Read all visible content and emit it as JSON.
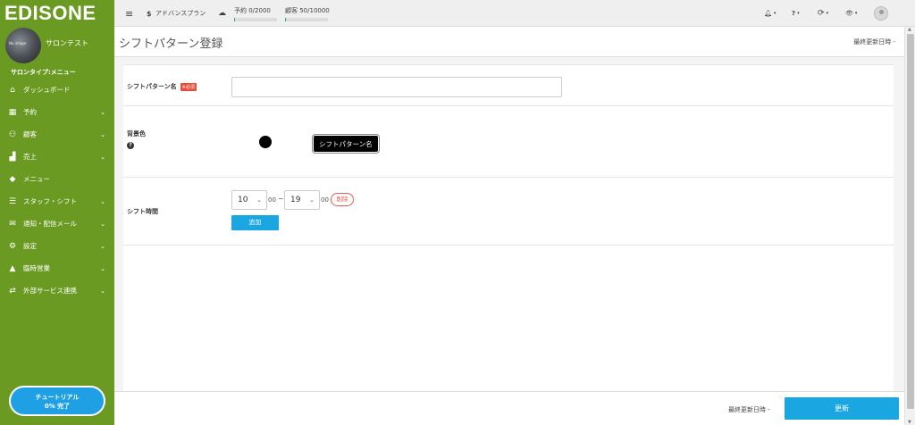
{
  "brand": "EDISONE",
  "profile": {
    "name": "サロンテスト",
    "image_text": "No image",
    "salon_type": "サロンタイプ:メニュー"
  },
  "sidebar": {
    "items": [
      {
        "icon": "home-icon",
        "glyph": "⌂",
        "label": "ダッシュボード",
        "has_chevron": false
      },
      {
        "icon": "calendar-icon",
        "glyph": "▦",
        "label": "予約",
        "has_chevron": true
      },
      {
        "icon": "users-icon",
        "glyph": "⚇",
        "label": "顧客",
        "has_chevron": true
      },
      {
        "icon": "chart-icon",
        "glyph": "▟",
        "label": "売上",
        "has_chevron": true
      },
      {
        "icon": "tag-icon",
        "glyph": "◆",
        "label": "メニュー",
        "has_chevron": false
      },
      {
        "icon": "sliders-icon",
        "glyph": "☰",
        "label": "スタッフ・シフト",
        "has_chevron": true
      },
      {
        "icon": "mail-icon",
        "glyph": "✉",
        "label": "通知・配信メール",
        "has_chevron": true
      },
      {
        "icon": "gear-icon",
        "glyph": "⚙",
        "label": "設定",
        "has_chevron": true
      },
      {
        "icon": "warning-icon",
        "glyph": "▲",
        "label": "臨時営業",
        "has_chevron": true
      },
      {
        "icon": "exchange-icon",
        "glyph": "⇄",
        "label": "外部サービス連携",
        "has_chevron": true
      }
    ],
    "chevron": "⌄"
  },
  "tutorial": {
    "line1": "チュートリアル",
    "line2": "0% 完了"
  },
  "topbar": {
    "menu_glyph": "≡",
    "plan_glyph": "$",
    "plan": "アドバンスプラン",
    "cloud_glyph": "☁",
    "reservations": "予約 0/2000",
    "reservations_progress": 0.0,
    "customers": "顧客 50/10000",
    "customers_progress": 0.005,
    "bell_glyph": "🔔︎",
    "help_glyph": "?",
    "refresh_glyph": "⟳",
    "eye_glyph": "👁︎",
    "caret": "▾"
  },
  "page": {
    "title": "シフトパターン登録",
    "last_updated_top": "最終更新日時 -"
  },
  "form": {
    "name_label": "シフトパターン名",
    "required_badge": "※必須",
    "name_value": "",
    "bg_color_label": "背景色",
    "help_glyph": "?",
    "bg_color": "#000000",
    "preview_text": "シフトパターン名",
    "shift_time_label": "シフト時間",
    "start_hour": "10",
    "start_minute": "00",
    "separator": "~",
    "end_hour": "19",
    "end_minute": "00",
    "delete_label": "削除",
    "add_label": "追加"
  },
  "footer": {
    "last_updated": "最終更新日時 -",
    "update_label": "更新"
  },
  "colors": {
    "sidebar": "#6b9a23",
    "primary": "#1aa6e0",
    "danger": "#e05a4f"
  }
}
